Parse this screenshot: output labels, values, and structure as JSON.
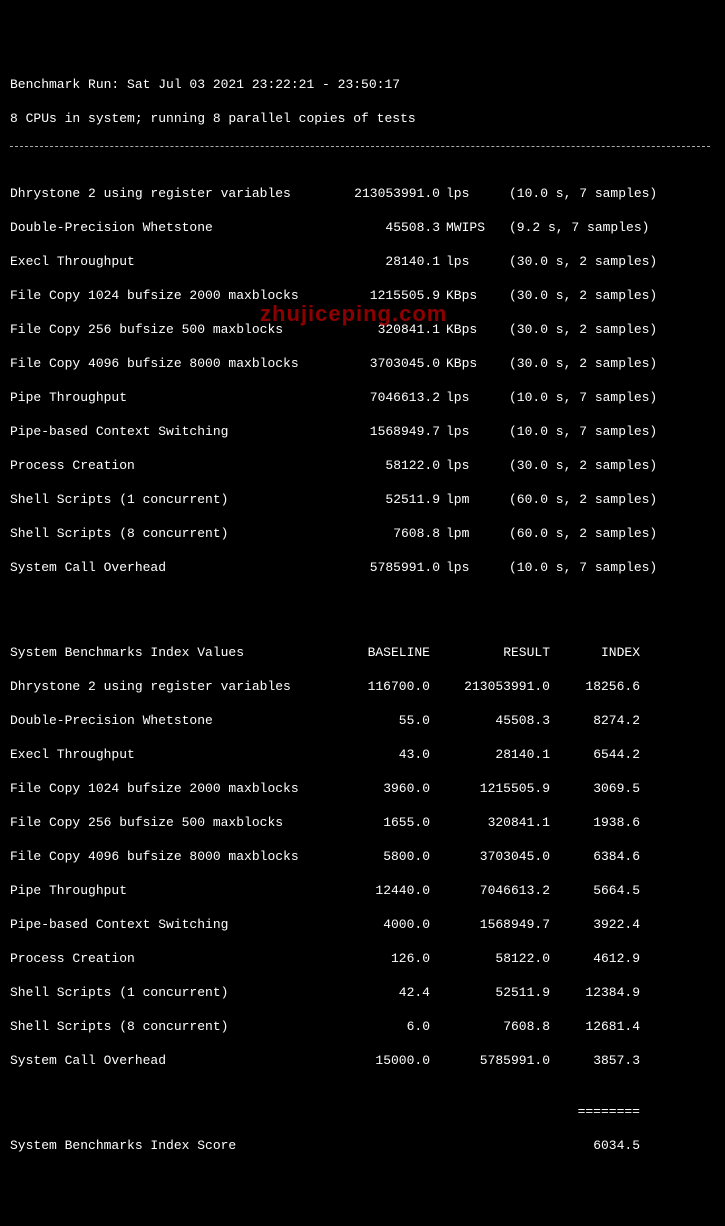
{
  "header": {
    "run_line": "Benchmark Run: Sat Jul 03 2021 23:22:21 - 23:50:17",
    "cpu_line": "8 CPUs in system; running 8 parallel copies of tests"
  },
  "tests": [
    {
      "name": "Dhrystone 2 using register variables",
      "value": "213053991.0",
      "unit": "lps",
      "note": "(10.0 s, 7 samples)"
    },
    {
      "name": "Double-Precision Whetstone",
      "value": "45508.3",
      "unit": "MWIPS",
      "note": "(9.2 s, 7 samples)"
    },
    {
      "name": "Execl Throughput",
      "value": "28140.1",
      "unit": "lps",
      "note": "(30.0 s, 2 samples)"
    },
    {
      "name": "File Copy 1024 bufsize 2000 maxblocks",
      "value": "1215505.9",
      "unit": "KBps",
      "note": "(30.0 s, 2 samples)"
    },
    {
      "name": "File Copy 256 bufsize 500 maxblocks",
      "value": "320841.1",
      "unit": "KBps",
      "note": "(30.0 s, 2 samples)"
    },
    {
      "name": "File Copy 4096 bufsize 8000 maxblocks",
      "value": "3703045.0",
      "unit": "KBps",
      "note": "(30.0 s, 2 samples)"
    },
    {
      "name": "Pipe Throughput",
      "value": "7046613.2",
      "unit": "lps",
      "note": "(10.0 s, 7 samples)"
    },
    {
      "name": "Pipe-based Context Switching",
      "value": "1568949.7",
      "unit": "lps",
      "note": "(10.0 s, 7 samples)"
    },
    {
      "name": "Process Creation",
      "value": "58122.0",
      "unit": "lps",
      "note": "(30.0 s, 2 samples)"
    },
    {
      "name": "Shell Scripts (1 concurrent)",
      "value": "52511.9",
      "unit": "lpm",
      "note": "(60.0 s, 2 samples)"
    },
    {
      "name": "Shell Scripts (8 concurrent)",
      "value": "7608.8",
      "unit": "lpm",
      "note": "(60.0 s, 2 samples)"
    },
    {
      "name": "System Call Overhead",
      "value": "5785991.0",
      "unit": "lps",
      "note": "(10.0 s, 7 samples)"
    }
  ],
  "index_header": {
    "title": "System Benchmarks Index Values",
    "baseline": "BASELINE",
    "result": "RESULT",
    "index": "INDEX"
  },
  "index": [
    {
      "name": "Dhrystone 2 using register variables",
      "baseline": "116700.0",
      "result": "213053991.0",
      "index": "18256.6"
    },
    {
      "name": "Double-Precision Whetstone",
      "baseline": "55.0",
      "result": "45508.3",
      "index": "8274.2"
    },
    {
      "name": "Execl Throughput",
      "baseline": "43.0",
      "result": "28140.1",
      "index": "6544.2"
    },
    {
      "name": "File Copy 1024 bufsize 2000 maxblocks",
      "baseline": "3960.0",
      "result": "1215505.9",
      "index": "3069.5"
    },
    {
      "name": "File Copy 256 bufsize 500 maxblocks",
      "baseline": "1655.0",
      "result": "320841.1",
      "index": "1938.6"
    },
    {
      "name": "File Copy 4096 bufsize 8000 maxblocks",
      "baseline": "5800.0",
      "result": "3703045.0",
      "index": "6384.6"
    },
    {
      "name": "Pipe Throughput",
      "baseline": "12440.0",
      "result": "7046613.2",
      "index": "5664.5"
    },
    {
      "name": "Pipe-based Context Switching",
      "baseline": "4000.0",
      "result": "1568949.7",
      "index": "3922.4"
    },
    {
      "name": "Process Creation",
      "baseline": "126.0",
      "result": "58122.0",
      "index": "4612.9"
    },
    {
      "name": "Shell Scripts (1 concurrent)",
      "baseline": "42.4",
      "result": "52511.9",
      "index": "12384.9"
    },
    {
      "name": "Shell Scripts (8 concurrent)",
      "baseline": "6.0",
      "result": "7608.8",
      "index": "12681.4"
    },
    {
      "name": "System Call Overhead",
      "baseline": "15000.0",
      "result": "5785991.0",
      "index": "3857.3"
    }
  ],
  "score": {
    "label": "System Benchmarks Index Score",
    "equals": "========",
    "value": "6034.5"
  },
  "watermark": "zhujiceping.com"
}
